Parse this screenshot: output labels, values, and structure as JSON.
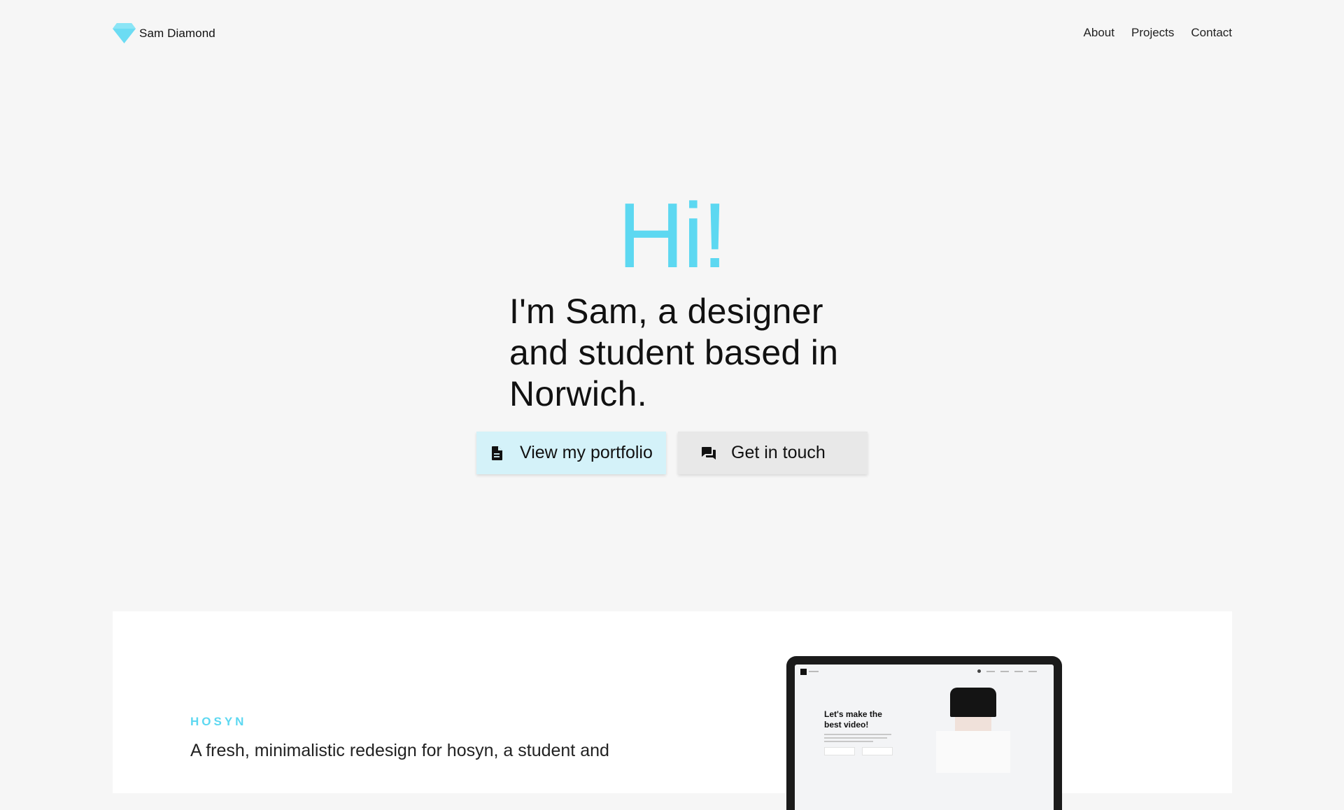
{
  "header": {
    "brand_name": "Sam Diamond",
    "nav": [
      {
        "label": "About"
      },
      {
        "label": "Projects"
      },
      {
        "label": "Contact"
      }
    ]
  },
  "hero": {
    "greeting": "Hi!",
    "intro": "I'm Sam, a designer and student based in Norwich.",
    "primary_button": {
      "label": "View my portfolio",
      "icon": "document-icon"
    },
    "secondary_button": {
      "label": "Get in touch",
      "icon": "chat-icon"
    }
  },
  "project": {
    "tag": "HOSYN",
    "description": "A fresh, minimalistic redesign for hosyn, a student and",
    "mockup": {
      "heading": "Let's make the best video!"
    }
  },
  "colors": {
    "accent": "#5dd8f1",
    "background": "#f6f6f6",
    "primary_button_bg": "#d4f2f9",
    "secondary_button_bg": "#e8e8e8",
    "card_bg": "#ffffff"
  }
}
